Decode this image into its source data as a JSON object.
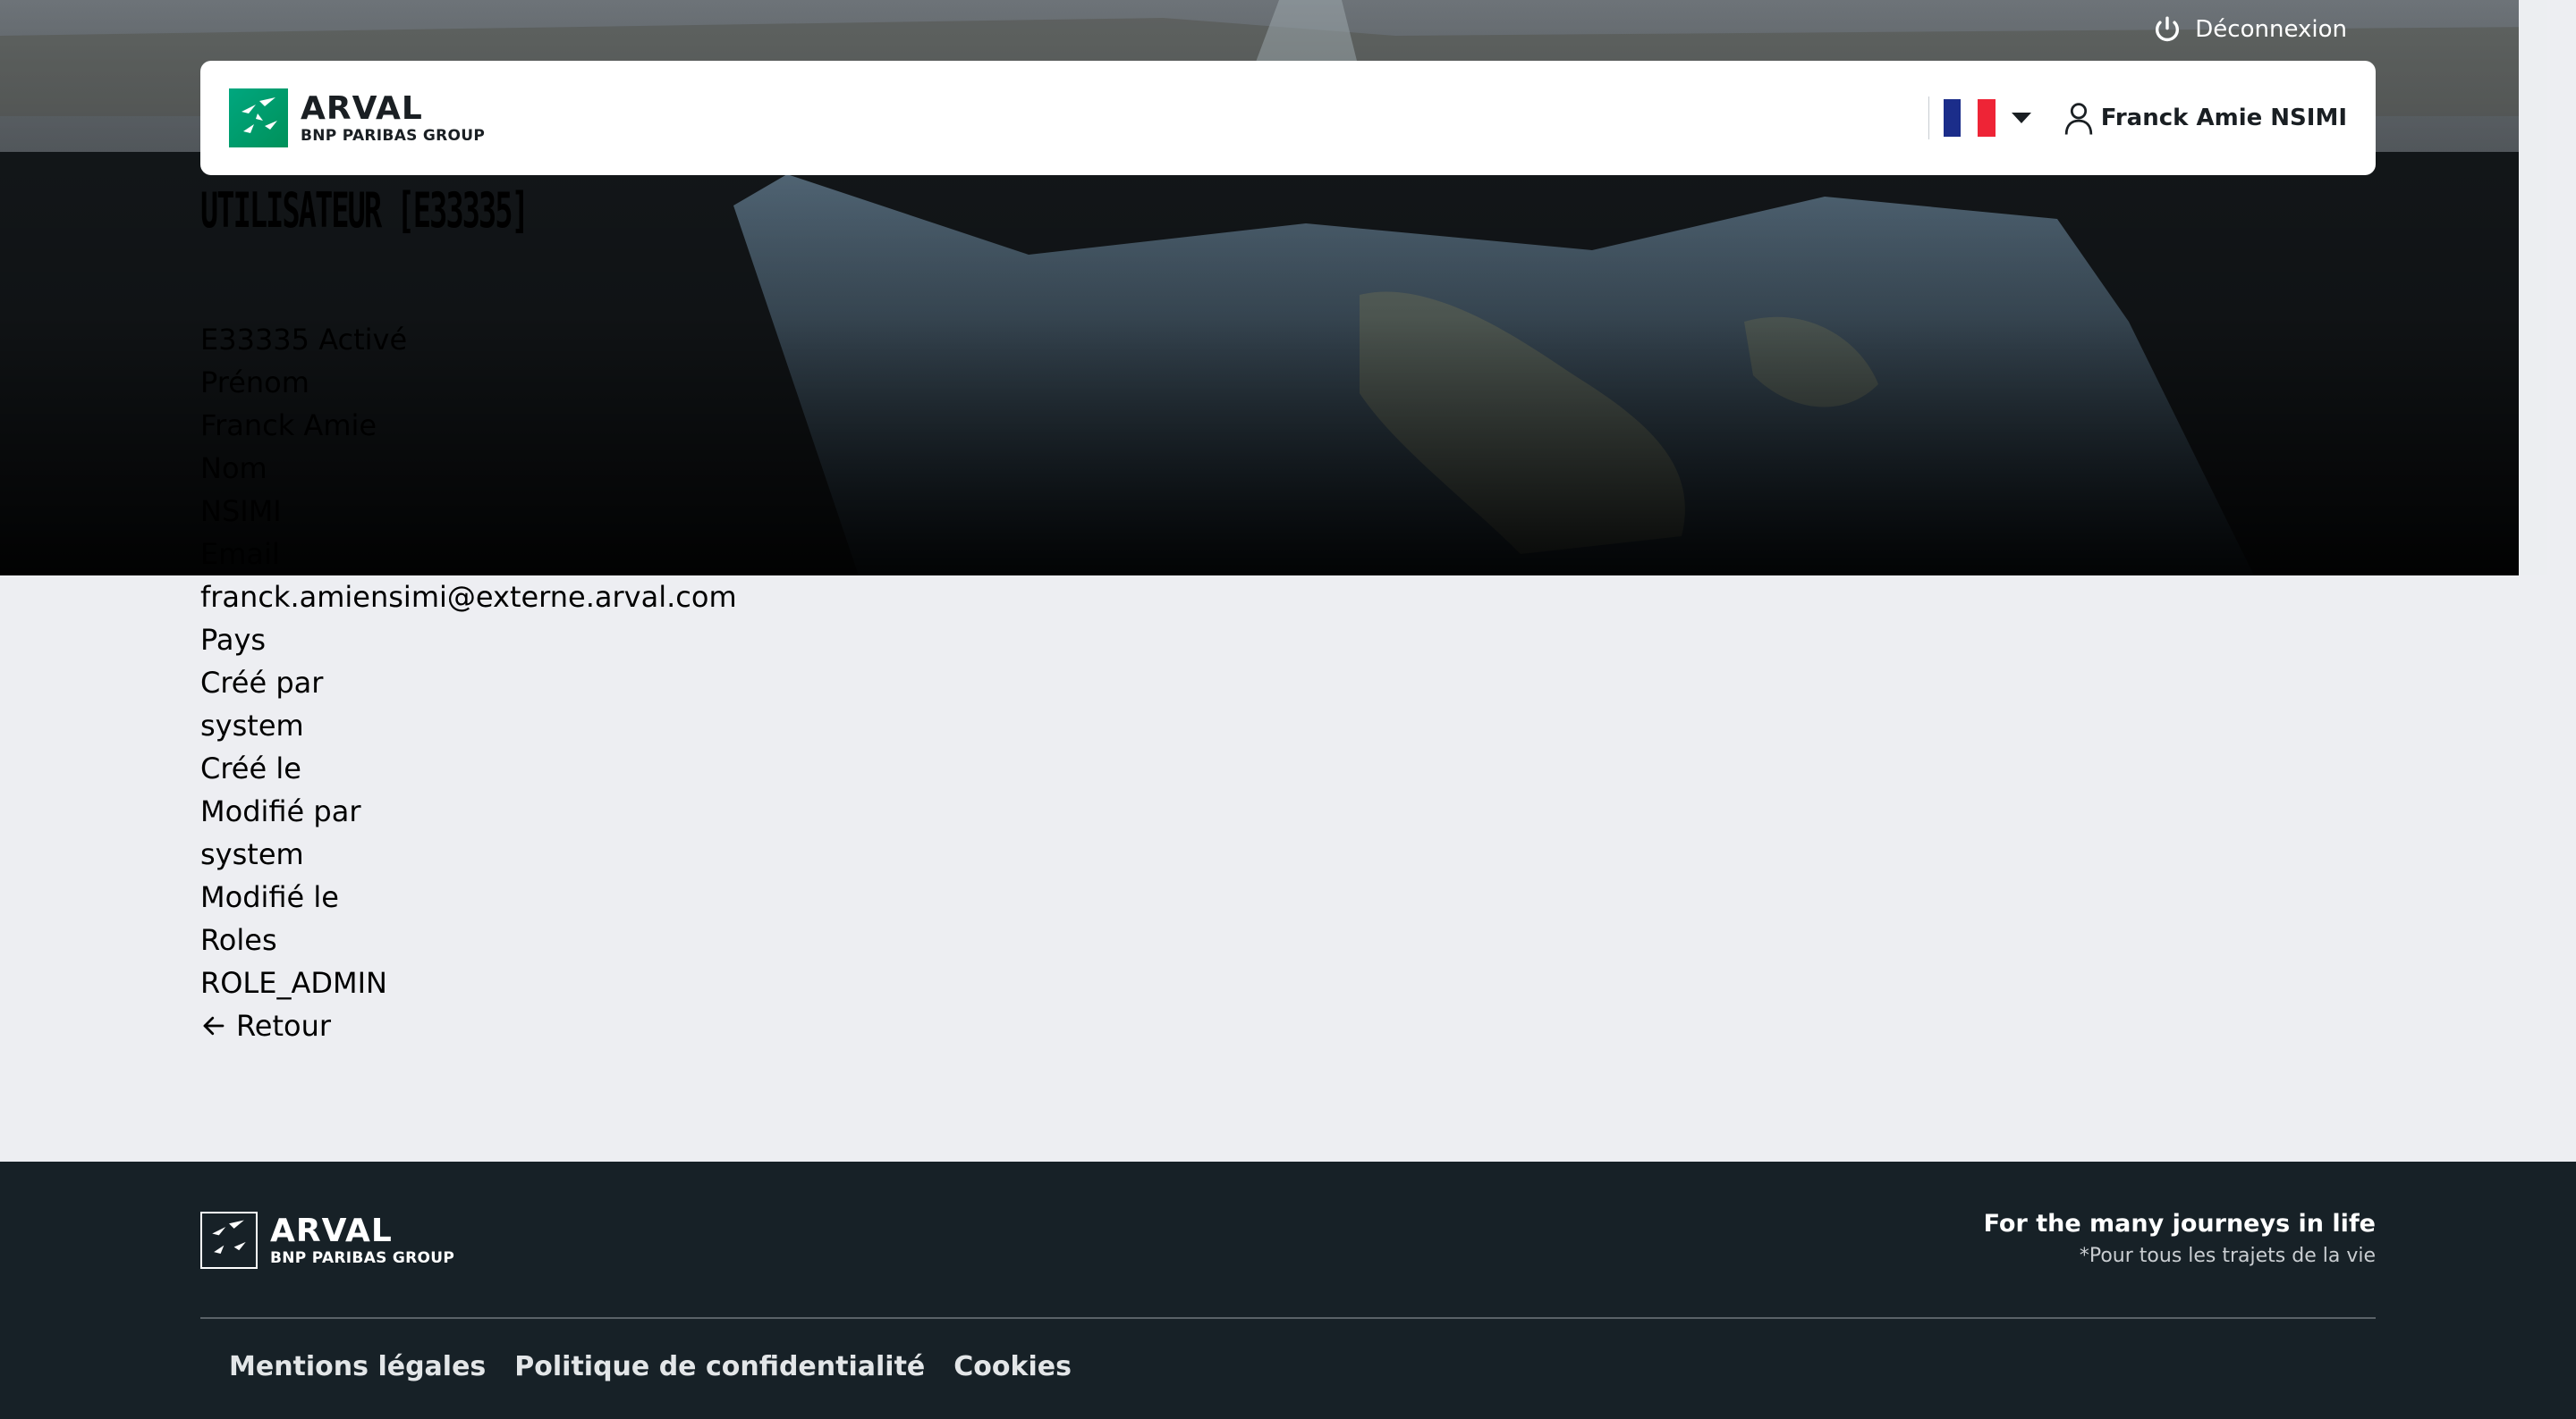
{
  "top_bar": {
    "logout_label": "Déconnexion",
    "logout_icon": "power-icon"
  },
  "header": {
    "logo_name": "ARVAL",
    "logo_group": "BNP PARIBAS GROUP",
    "language_flag": "flag-france-icon",
    "user_icon": "user-icon",
    "user_name": "Franck Amie NSIMI"
  },
  "main": {
    "title": "UTILISATEUR [E33335]",
    "details": [
      "E33335 Activé",
      "Prénom",
      "Franck Amie",
      "Nom",
      "NSIMI",
      "Email",
      "franck.amiensimi@externe.arval.com",
      "Pays",
      "Créé par",
      "system",
      "Créé le",
      "Modifié par",
      "system",
      "Modifié le",
      "Roles",
      "ROLE_ADMIN"
    ],
    "back_label": "Retour"
  },
  "footer": {
    "logo_name": "ARVAL",
    "logo_group": "BNP PARIBAS GROUP",
    "tagline": "For the many journeys in life",
    "tagline_sub": "*Pour tous les trajets de la vie",
    "links": [
      "Mentions légales",
      "Politique de confidentialité",
      "Cookies"
    ]
  },
  "colors": {
    "brand_green": "#00a77f",
    "footer_bg": "#172127",
    "page_bg": "#edeef2"
  }
}
